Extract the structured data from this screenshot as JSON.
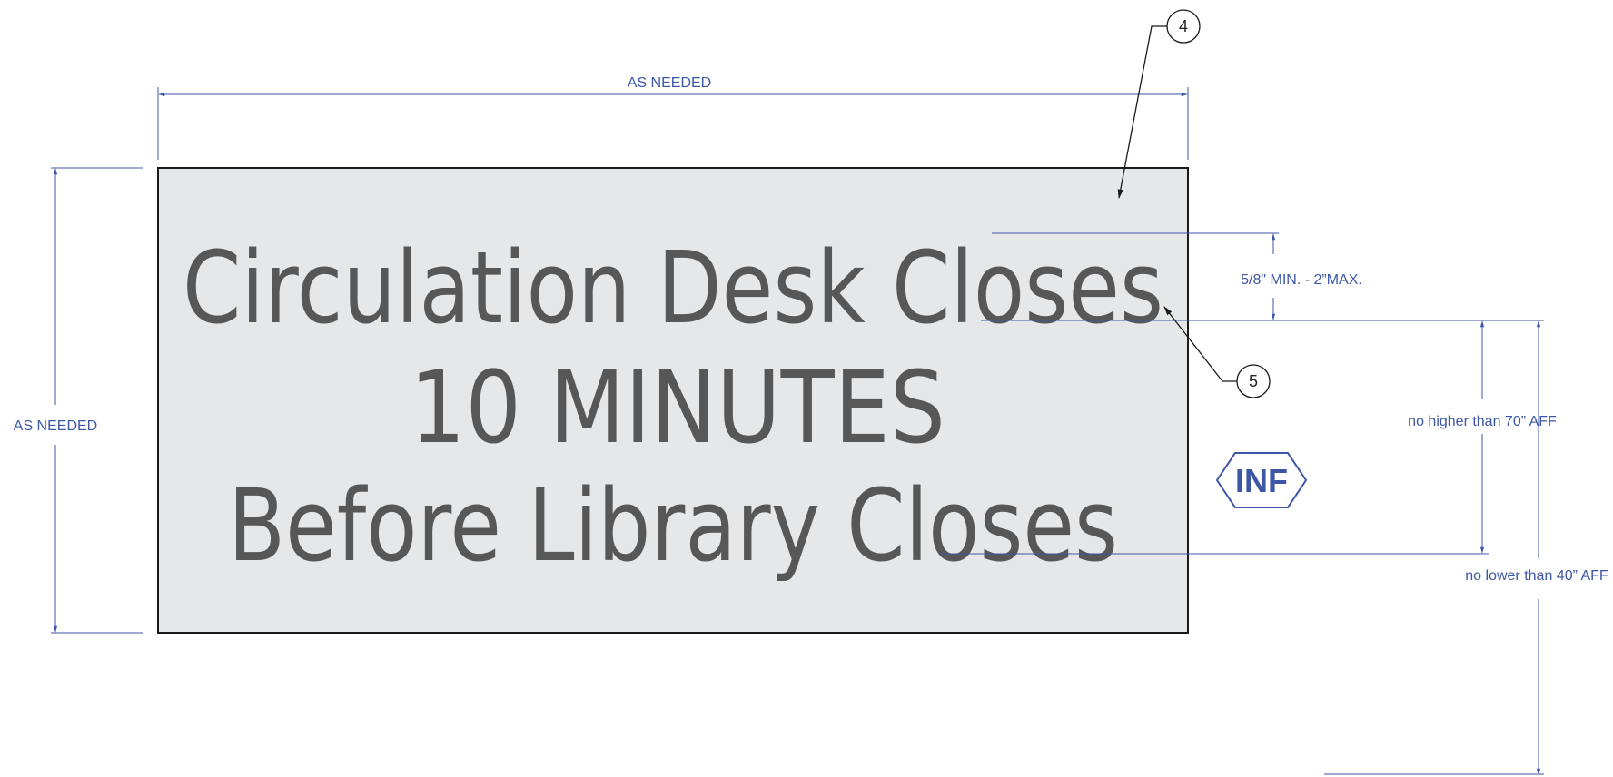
{
  "dimensions": {
    "width_label": "AS NEEDED",
    "height_label": "AS NEEDED",
    "cap_height_label": "5/8\" MIN. - 2”MAX.",
    "max_height_label": "no higher than 70” AFF",
    "min_height_label": "no lower than 40” AFF"
  },
  "sign": {
    "line1": "Circulation Desk Closes",
    "line2": "10 MINUTES",
    "line3": "Before Library Closes"
  },
  "callouts": {
    "panel": "4",
    "text": "5"
  },
  "badge": {
    "label": "INF"
  },
  "colors": {
    "dimension_line": "#3d56a6",
    "sign_panel": "#e6e7e8",
    "sign_text": "#575757",
    "outline": "#1a1a1a"
  }
}
